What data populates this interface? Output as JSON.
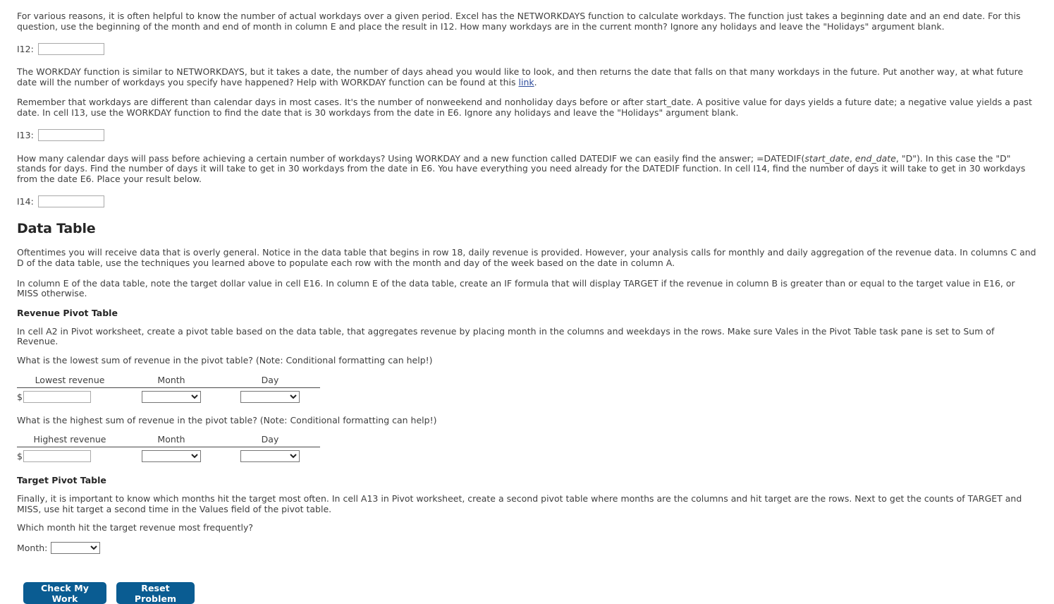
{
  "paragraphs": {
    "networkdays_intro": "For various reasons, it is often helpful to know the number of actual workdays over a given period. Excel has the NETWORKDAYS function to calculate workdays. The function just takes a beginning date and an end date. For this question, use the beginning of the month and end of month in column E and place the result in I12. How many workdays are in the current month? Ignore any holidays and leave the \"Holidays\" argument blank.",
    "workday_intro_a": "The WORKDAY function is similar to NETWORKDAYS, but it takes a date, the number of days ahead you would like to look, and then returns the date that falls on that many workdays in the future. Put another way, at what future date will the number of workdays you specify have happened? Help with WORKDAY function can be found at this ",
    "workday_link_text": "link",
    "workday_intro_b": ".",
    "workday_detail": "Remember that workdays are different than calendar days in most cases. It's the number of nonweekend and nonholiday days before or after start_date. A positive value for days yields a future date; a negative value yields a past date. In cell I13, use the WORKDAY function to find the date that is 30 workdays from the date in E6. Ignore any holidays and leave the \"Holidays\" argument blank.",
    "datedif_a": "How many calendar days will pass before achieving a certain number of workdays? Using WORKDAY and a new function called DATEDIF we can easily find the answer; =DATEDIF(",
    "datedif_arg1": "start_date",
    "datedif_sep": ", ",
    "datedif_arg2": "end_date",
    "datedif_b": ", \"D\"). In this case the \"D\" stands for days. Find the number of days it will take to get in 30 workdays from the date in E6. You have everything you need already for the DATEDIF function. In cell I14, find the number of days it will take to get in 30 workdays from the date E6. Place your result below.",
    "data_table_intro": "Oftentimes you will receive data that is overly general. Notice in the data table that begins in row 18, daily revenue is provided. However, your analysis calls for monthly and daily aggregation of the revenue data. In columns C and D of the data table, use the techniques you learned above to populate each row with the month and day of the week based on the date in column A.",
    "target_column_e": "In column E of the data table, note the target dollar value in cell E16. In column E of the data table, create an IF formula that will display TARGET if the revenue in column B is greater than or equal to the target value in E16, or MISS otherwise.",
    "revenue_pivot_intro": "In cell A2 in Pivot worksheet, create a pivot table based on the data table, that aggregates revenue by placing month in the columns and weekdays in the rows. Make sure Vales in the Pivot Table task pane is set to Sum of Revenue.",
    "lowest_question": "What is the lowest sum of revenue in the pivot table? (Note: Conditional formatting can help!)",
    "highest_question": "What is the highest sum of revenue in the pivot table? (Note: Conditional formatting can help!)",
    "target_pivot_intro": "Finally, it is important to know which months hit the target most often. In cell A13 in Pivot worksheet, create a second pivot table where months are the columns and hit target are the rows. Next to get the counts of TARGET and MISS, use hit target a second time in the Values field of the pivot table.",
    "which_month_question": "Which month hit the target revenue most frequently?"
  },
  "headings": {
    "data_table": "Data Table",
    "revenue_pivot_table": "Revenue Pivot Table",
    "target_pivot_table": "Target Pivot Table"
  },
  "answers": {
    "i12_label": "I12:",
    "i12_value": "",
    "i13_label": "I13:",
    "i13_value": "",
    "i14_label": "I14:",
    "i14_value": "",
    "month_label": "Month:"
  },
  "lowest_table": {
    "headers": [
      "Lowest revenue",
      "Month",
      "Day"
    ],
    "dollar_prefix": "$",
    "revenue_value": "",
    "month_selected": "",
    "day_selected": ""
  },
  "highest_table": {
    "headers": [
      "Highest revenue",
      "Month",
      "Day"
    ],
    "dollar_prefix": "$",
    "revenue_value": "",
    "month_selected": "",
    "day_selected": ""
  },
  "month_dropdown": {
    "selected": ""
  },
  "buttons": {
    "check": "Check My Work",
    "reset": "Reset Problem"
  },
  "colors": {
    "button_blue": "#0a5c92",
    "link_blue": "#2b4a9b",
    "text": "#3f3f3f",
    "heading": "#262626"
  }
}
